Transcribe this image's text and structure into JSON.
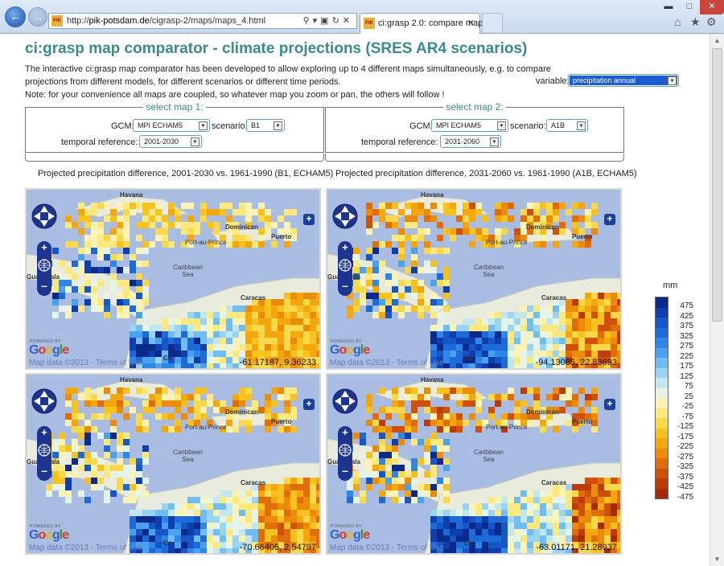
{
  "browser": {
    "url_prefix": "http://",
    "url_domain": "pik-potsdam.de",
    "url_path": "/cigrasp-2/maps/maps_4.html",
    "tab_title": "ci:grasp 2.0: compare maps",
    "favicon_text": "PIK"
  },
  "page": {
    "title": "ci:grasp map comparator - climate projections (SRES AR4 scenarios)",
    "intro_line1": "The interactive ci:grasp map comparator has been developed to allow exploring up to 4 different maps simultaneously, e.g. to compare",
    "intro_line2": "projections from different models, for different scenarios or different time periods.",
    "intro_line3": "Note: for your convenience all maps are coupled, so whatever map you zoom or pan, the others will follow !",
    "variable_label": "variable:",
    "variable_value": "precipitation annual"
  },
  "map_selectors": [
    {
      "title": "select map 1:",
      "gcm_label": "GCM:",
      "gcm_value": "MPI ECHAM5",
      "scenario_label": "scenario:",
      "scenario_value": "B1",
      "temporal_label": "temporal reference:",
      "temporal_value": "2001-2030"
    },
    {
      "title": "select map 2:",
      "gcm_label": "GCM:",
      "gcm_value": "MPI ECHAM5",
      "scenario_label": "scenario:",
      "scenario_value": "A1B",
      "temporal_label": "temporal reference:",
      "temporal_value": "2031-2060"
    }
  ],
  "captions": [
    "Projected precipitation difference, 2001-2030 vs. 1961-1990 (B1, ECHAM5)",
    "Projected precipitation difference, 2031-2060 vs. 1961-1990 (A1B, ECHAM5)"
  ],
  "map_labels": {
    "havana": "Havana",
    "dominican": "Dominican",
    "puerto": "Puerto",
    "port_au_prince": "Port-au-Prince",
    "caribbean": "Caribbean",
    "sea": "Sea",
    "guatemala": "Guatemala",
    "caracas": "Caracas",
    "ca": "Ca",
    "powered_by": "POWERED BY",
    "google_g1": "G",
    "google_o1": "o",
    "google_o2": "o",
    "google_g2": "g",
    "google_l": "l",
    "google_e": "e",
    "map_data": "Map data ©2013",
    "separator": " - ",
    "terms": "Terms of Use"
  },
  "maps": [
    {
      "coords": "-61.17187, 9.36233",
      "intensity": 0.25
    },
    {
      "coords": "-94.13085, 22.83693",
      "intensity": 0.75
    },
    {
      "coords": "-70.66405, 2.54797",
      "intensity": 0.55
    },
    {
      "coords": "-63.01171, 21.28937",
      "intensity": 0.95
    }
  ],
  "legend": {
    "unit": "mm",
    "labels": [
      "475",
      "425",
      "375",
      "325",
      "275",
      "225",
      "175",
      "125",
      "75",
      "25",
      "-25",
      "-75",
      "-125",
      "-175",
      "-225",
      "-275",
      "-325",
      "-375",
      "-425",
      "-475"
    ],
    "colors": [
      "#0b2a8a",
      "#0f3fae",
      "#1656c8",
      "#1d6bd9",
      "#2e86e6",
      "#48a2ef",
      "#6fbdf3",
      "#99d4f2",
      "#c2e7ef",
      "#e4f4e8",
      "#fbf3b5",
      "#fbe97e",
      "#f9d84a",
      "#f7c21e",
      "#f3a70d",
      "#ec8a0a",
      "#e06c0a",
      "#d0500a",
      "#bd3a09",
      "#a52a08"
    ]
  }
}
